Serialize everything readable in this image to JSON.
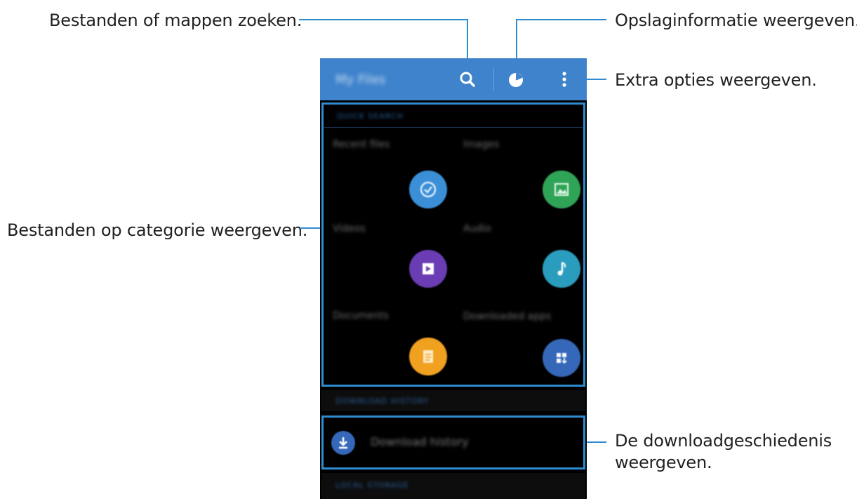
{
  "callouts": {
    "search": "Bestanden of mappen zoeken.",
    "storage": "Opslaginformatie weergeven.",
    "more": "Extra opties weergeven.",
    "categories": "Bestanden op categorie weergeven.",
    "download_line1": "De downloadgeschiedenis",
    "download_line2": "weergeven."
  },
  "appbar": {
    "title": "My Files",
    "icons": [
      "search-icon",
      "storage-usage-icon",
      "more-options-icon"
    ],
    "color": "#3f83cc"
  },
  "categories_header": "QUICK SEARCH",
  "categories": [
    {
      "label": "Recent files",
      "icon": "clock-icon",
      "color": "#3b8fd6"
    },
    {
      "label": "Images",
      "icon": "image-icon",
      "color": "#2fa457"
    },
    {
      "label": "Videos",
      "icon": "video-icon",
      "color": "#6a3db4"
    },
    {
      "label": "Audio",
      "icon": "music-note-icon",
      "color": "#2a9dbf"
    },
    {
      "label": "Documents",
      "icon": "document-icon",
      "color": "#f0a11f"
    },
    {
      "label": "Downloaded apps",
      "icon": "apps-icon",
      "color": "#3568b8"
    }
  ],
  "download_header": "DOWNLOAD HISTORY",
  "download_item": {
    "label": "Download history",
    "icon": "download-icon",
    "color": "#3568b8"
  },
  "storage_header": "LOCAL STORAGE",
  "accent_color": "#2f8bd0"
}
